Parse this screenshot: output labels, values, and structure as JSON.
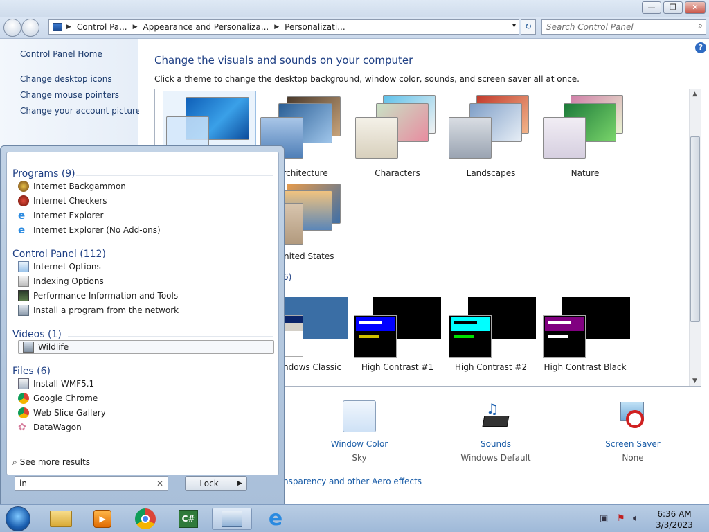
{
  "window": {
    "minimize": "—",
    "maximize": "❐",
    "close": "✕"
  },
  "address": {
    "crumbs": [
      "Control Pa...",
      "Appearance and Personaliza...",
      "Personalizati..."
    ],
    "dropdown": "▾",
    "refresh": "↻"
  },
  "search": {
    "placeholder": "Search Control Panel",
    "icon": "search-icon"
  },
  "left_nav": {
    "home": "Control Panel Home",
    "links": [
      "Change desktop icons",
      "Change mouse pointers",
      "Change your account picture"
    ]
  },
  "main": {
    "help": "?",
    "title": "Change the visuals and sounds on your computer",
    "subtitle": "Click a theme to change the desktop background, window color, sounds, and screen saver all at once.",
    "themes": [
      "Architecture",
      "Characters",
      "Landscapes",
      "Nature"
    ],
    "themes_row2": [
      "nited States"
    ],
    "basic_group_count": "6)",
    "basic_themes": [
      "ndows Classic",
      "High Contrast #1",
      "High Contrast #2",
      "High Contrast Black"
    ],
    "bottom": {
      "window_color": {
        "label": "Window Color",
        "value": "Sky"
      },
      "sounds": {
        "label": "Sounds",
        "value": "Windows Default"
      },
      "screen_saver": {
        "label": "Screen Saver",
        "value": "None"
      }
    },
    "aero_link": "nsparency and other Aero effects"
  },
  "start_menu": {
    "programs_header": "Programs (9)",
    "programs": [
      "Internet Backgammon",
      "Internet Checkers",
      "Internet Explorer",
      "Internet Explorer (No Add-ons)"
    ],
    "control_panel_header": "Control Panel (112)",
    "control_panel": [
      "Internet Options",
      "Indexing Options",
      "Performance Information and Tools",
      "Install a program from the network"
    ],
    "videos_header": "Videos (1)",
    "videos": [
      "Wildlife"
    ],
    "files_header": "Files (6)",
    "files": [
      "Install-WMF5.1",
      "Google Chrome",
      "Web Slice Gallery",
      "DataWagon"
    ],
    "see_more": "See more results",
    "search_value": "in",
    "clear": "✕",
    "lock_label": "Lock",
    "lock_caret": "▶"
  },
  "taskbar": {
    "apps": [
      "file-explorer-icon",
      "media-player-icon",
      "chrome-icon",
      "csharp-icon",
      "control-panel-icon",
      "internet-explorer-icon"
    ],
    "time": "6:36 AM",
    "date": "3/3/2023"
  },
  "colors": {
    "link": "#1c5ea8",
    "heading": "#1e3f84",
    "high_contrast_1": "#0000ff",
    "high_contrast_2": "#00ffff",
    "high_contrast_black": "#800080"
  }
}
